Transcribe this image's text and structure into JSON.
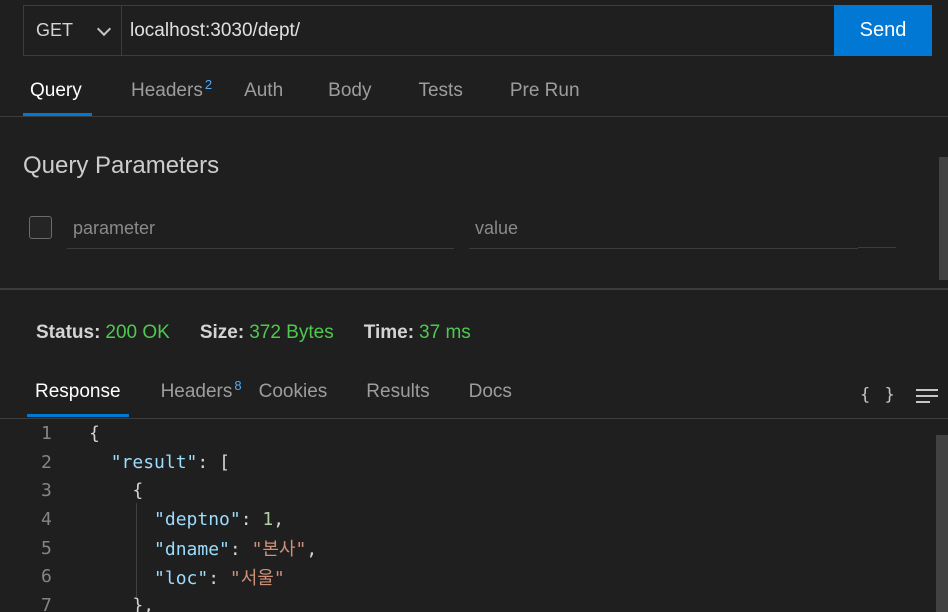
{
  "request": {
    "method": "GET",
    "url": "localhost:3030/dept/",
    "send_label": "Send"
  },
  "request_tabs": [
    {
      "label": "Query",
      "active": true
    },
    {
      "label": "Headers",
      "badge": "2"
    },
    {
      "label": "Auth"
    },
    {
      "label": "Body"
    },
    {
      "label": "Tests"
    },
    {
      "label": "Pre Run"
    }
  ],
  "query": {
    "title": "Query Parameters",
    "param_placeholder": "parameter",
    "value_placeholder": "value"
  },
  "status": {
    "status_label": "Status:",
    "status_value": "200 OK",
    "size_label": "Size:",
    "size_value": "372 Bytes",
    "time_label": "Time:",
    "time_value": "37 ms"
  },
  "response_tabs": [
    {
      "label": "Response",
      "active": true
    },
    {
      "label": "Headers",
      "badge": "8"
    },
    {
      "label": "Cookies"
    },
    {
      "label": "Results"
    },
    {
      "label": "Docs"
    }
  ],
  "response_icons": {
    "braces": "{ }",
    "format": "menu-icon"
  },
  "code_lines": [
    {
      "n": "1",
      "indent": "",
      "parts": [
        [
          "p",
          "{"
        ]
      ]
    },
    {
      "n": "2",
      "indent": "  ",
      "parts": [
        [
          "k",
          "\"result\""
        ],
        [
          "p",
          ": ["
        ]
      ]
    },
    {
      "n": "3",
      "indent": "    ",
      "parts": [
        [
          "p",
          "{"
        ]
      ]
    },
    {
      "n": "4",
      "indent": "      ",
      "parts": [
        [
          "k",
          "\"deptno\""
        ],
        [
          "p",
          ": "
        ],
        [
          "n",
          "1"
        ],
        [
          "p",
          ","
        ]
      ]
    },
    {
      "n": "5",
      "indent": "      ",
      "parts": [
        [
          "k",
          "\"dname\""
        ],
        [
          "p",
          ": "
        ],
        [
          "s",
          "\"본사\""
        ],
        [
          "p",
          ","
        ]
      ]
    },
    {
      "n": "6",
      "indent": "      ",
      "parts": [
        [
          "k",
          "\"loc\""
        ],
        [
          "p",
          ": "
        ],
        [
          "s",
          "\"서울\""
        ]
      ]
    },
    {
      "n": "7",
      "indent": "    ",
      "parts": [
        [
          "p",
          "},"
        ]
      ]
    }
  ],
  "colors": {
    "accent": "#0078d4",
    "status_ok": "#4ec94e",
    "json_key": "#9cdcfe",
    "json_string": "#ce9178",
    "json_number": "#b5cea8"
  }
}
